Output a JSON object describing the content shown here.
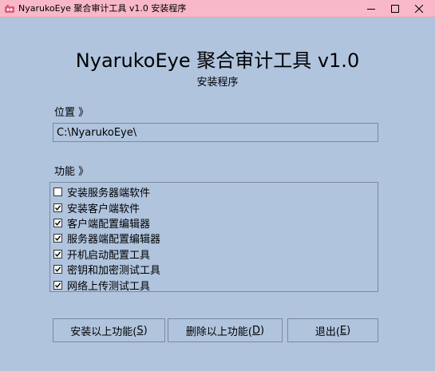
{
  "window": {
    "title": "NyarukoEye 聚合审计工具 v1.0 安装程序",
    "controls": {
      "minimize": "minimize-icon",
      "maximize": "maximize-icon",
      "close": "close-icon"
    },
    "titlebar_color": "#f8b8c8",
    "background_color": "#b0c4de"
  },
  "header": {
    "title": "NyarukoEye 聚合审计工具 v1.0",
    "subtitle": "安装程序"
  },
  "location": {
    "label": "位置 》",
    "value": "C:\\NyarukoEye\\"
  },
  "features": {
    "label": "功能 》",
    "items": [
      {
        "label": "安装服务器端软件",
        "checked": false
      },
      {
        "label": "安装客户端软件",
        "checked": true
      },
      {
        "label": "客户端配置编辑器",
        "checked": true
      },
      {
        "label": "服务器端配置编辑器",
        "checked": true
      },
      {
        "label": "开机启动配置工具",
        "checked": true
      },
      {
        "label": "密钥和加密测试工具",
        "checked": true
      },
      {
        "label": "网络上传测试工具",
        "checked": true
      }
    ]
  },
  "buttons": {
    "install": {
      "text": "安装以上功能(",
      "key": "S",
      "end": ")"
    },
    "delete": {
      "text": "删除以上功能(",
      "key": "D",
      "end": ")"
    },
    "exit": {
      "text": "退出(",
      "key": "E",
      "end": ")"
    }
  }
}
